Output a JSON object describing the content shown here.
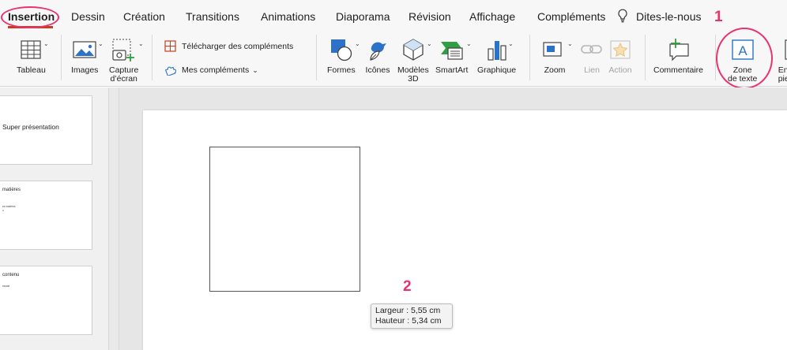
{
  "tabs": {
    "insertion": "Insertion",
    "dessin": "Dessin",
    "creation": "Création",
    "transitions": "Transitions",
    "animations": "Animations",
    "diaporama": "Diaporama",
    "revision": "Révision",
    "affichage": "Affichage",
    "complements": "Compléments",
    "tell_me": "Dites-le-nous"
  },
  "ribbon": {
    "tableau": "Tableau",
    "images": "Images",
    "capture": "Capture\nd’écran",
    "telecharger": "Télécharger des compléments",
    "mes_complements": "Mes compléments",
    "mes_complements_caret": "⌄",
    "formes": "Formes",
    "icones": "Icônes",
    "modeles3d": "Modèles\n3D",
    "smartart": "SmartArt",
    "graphique": "Graphique",
    "zoom": "Zoom",
    "lien": "Lien",
    "action": "Action",
    "commentaire": "Commentaire",
    "zone_texte": "Zone\nde texte",
    "entete": "En-t\npied d"
  },
  "annotations": {
    "one": "1",
    "two": "2"
  },
  "thumbnails": [
    {
      "title": "Super présentation",
      "lines": []
    },
    {
      "title": "matières",
      "lines": [
        "es matières",
        "u"
      ]
    },
    {
      "title": "contenu",
      "lines": [
        "essaie"
      ]
    }
  ],
  "tooltip": {
    "width": "Largeur : 5,55 cm",
    "height": "Hauteur : 5,34 cm"
  },
  "colors": {
    "accent": "#c43e1c",
    "annotation": "#e8336d",
    "icon_blue": "#2b72c8",
    "icon_green": "#2f9e44"
  }
}
